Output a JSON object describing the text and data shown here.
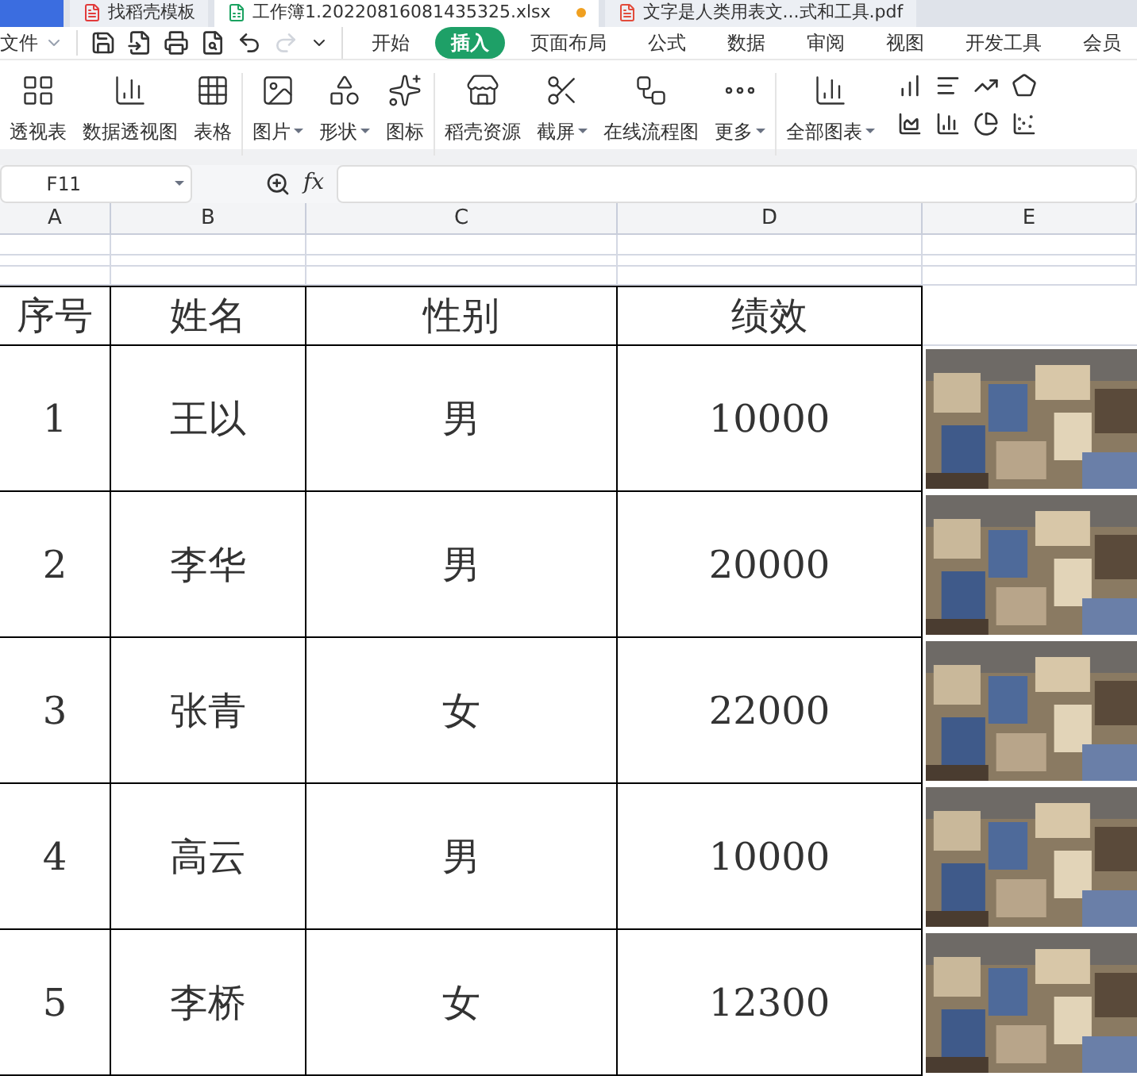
{
  "doc_tabs": [
    {
      "label": "找稻壳模板",
      "kind": "docer",
      "selected": false,
      "modified": false
    },
    {
      "label": "工作簿1.20220816081435325.xlsx",
      "kind": "sheet",
      "selected": true,
      "modified": true
    },
    {
      "label": "文字是人类用表文...式和工具.pdf",
      "kind": "pdf",
      "selected": false,
      "modified": false
    }
  ],
  "file_menu": "文件",
  "ribbon_tabs": [
    {
      "label": "开始",
      "selected": false
    },
    {
      "label": "插入",
      "selected": true
    },
    {
      "label": "页面布局",
      "selected": false
    },
    {
      "label": "公式",
      "selected": false
    },
    {
      "label": "数据",
      "selected": false
    },
    {
      "label": "审阅",
      "selected": false
    },
    {
      "label": "视图",
      "selected": false
    },
    {
      "label": "开发工具",
      "selected": false
    },
    {
      "label": "会员",
      "selected": false
    }
  ],
  "ribbon_groups": [
    [
      {
        "label": "透视表",
        "dropdown": false
      },
      {
        "label": "数据透视图",
        "dropdown": false
      },
      {
        "label": "表格",
        "dropdown": false
      }
    ],
    [
      {
        "label": "图片",
        "dropdown": true
      },
      {
        "label": "形状",
        "dropdown": true
      },
      {
        "label": "图标",
        "dropdown": false
      }
    ],
    [
      {
        "label": "稻壳资源",
        "dropdown": false
      },
      {
        "label": "截屏",
        "dropdown": true
      },
      {
        "label": "在线流程图",
        "dropdown": false
      },
      {
        "label": "更多",
        "dropdown": true
      }
    ],
    [
      {
        "label": "全部图表",
        "dropdown": true
      }
    ]
  ],
  "formula_bar": {
    "cell": "F11",
    "fx": "fx"
  },
  "columns": [
    "A",
    "B",
    "C",
    "D",
    "E"
  ],
  "table": {
    "header": [
      "序号",
      "姓名",
      "性别",
      "绩效"
    ],
    "rows": [
      [
        "1",
        "王以",
        "男",
        "10000"
      ],
      [
        "2",
        "李华",
        "男",
        "20000"
      ],
      [
        "3",
        "张青",
        "女",
        "22000"
      ],
      [
        "4",
        "高云",
        "男",
        "10000"
      ],
      [
        "5",
        "李桥",
        "女",
        "12300"
      ]
    ]
  }
}
